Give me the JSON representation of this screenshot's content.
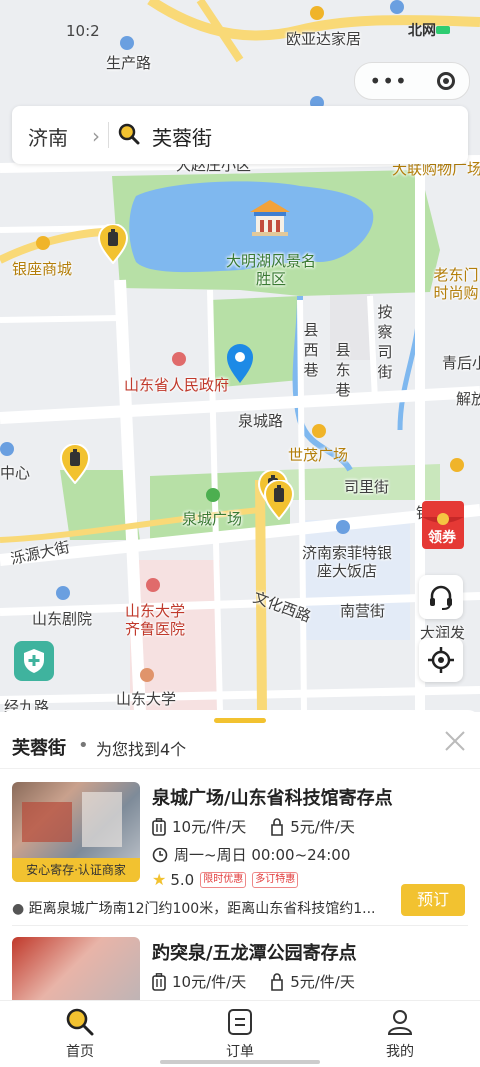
{
  "status_bar": {
    "time": "10:2",
    "right_text": "北网"
  },
  "search": {
    "city": "济南",
    "query": "芙蓉街"
  },
  "map": {
    "labels": {
      "shengchanlu": "生产路",
      "ouyada": "欧亚达家居",
      "dalian": "大联购物广场",
      "daqiao": "大赵庄小区",
      "yinzuo": "银座商城",
      "daminghu": "大明湖风景名胜区",
      "laodongmen": "老东门时尚购",
      "anchajie": "按察司街",
      "xianxixiang": "县西巷",
      "xiandongxiang": "县东巷",
      "qinghou": "青后小",
      "jiefang": "解放",
      "zhengfu": "山东省人民政府",
      "quanchenglu": "泉城路",
      "shimao": "世茂广场",
      "zhongxin": "中心",
      "silijie": "司里街",
      "quancheng_square": "泉城广场",
      "yinfeng": "银丰",
      "luoyuan": "泺源大街",
      "sofitel": "济南索菲特银座大饭店",
      "wenhua": "文化西路",
      "nanying": "南营街",
      "juyuan": "山东剧院",
      "qilu": "山东大学齐鲁医院",
      "shandong_univ": "山东大学",
      "dalunfa": "大润发",
      "jingjiu": "经九路"
    },
    "coupon_label": "领券"
  },
  "sheet": {
    "title": "芙蓉街",
    "separator": "•",
    "result_count": "为您找到4个",
    "items": [
      {
        "title": "泉城广场/山东省科技馆寄存点",
        "price_large": "10元/件/天",
        "price_small": "5元/件/天",
        "hours": "周一~周日 00:00~24:00",
        "rating": "5.0",
        "tags": [
          "限时优惠",
          "多订特惠"
        ],
        "badge": "安心寄存·认证商家",
        "distance": "距离泉城广场南12门约100米，距离山东省科技馆约1...",
        "button": "预订"
      },
      {
        "title": "趵突泉/五龙潭公园寄存点",
        "price_large": "10元/件/天",
        "price_small": "5元/件/天"
      }
    ]
  },
  "tabs": [
    {
      "label": "首页",
      "icon": "search-icon"
    },
    {
      "label": "订单",
      "icon": "order-icon"
    },
    {
      "label": "我的",
      "icon": "profile-icon"
    }
  ],
  "colors": {
    "accent": "#f2c230",
    "water": "#7fb8ef",
    "park": "#b7e0a6",
    "road": "#ffffff",
    "major_road": "#f9d977"
  }
}
